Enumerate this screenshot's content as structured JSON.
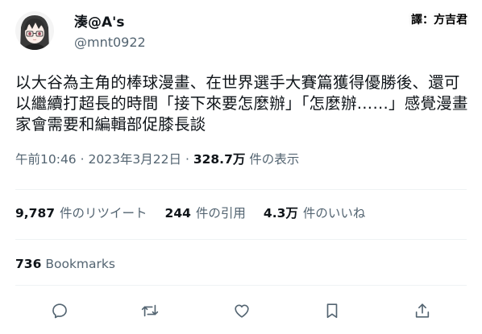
{
  "tweet": {
    "author": {
      "display_name": "湊@A's",
      "handle": "@mnt0922"
    },
    "text": "以大谷為主角的棒球漫畫、在世界選手大賽篇獲得優勝後、還可以繼續打超長的時間「接下來要怎麼辦」「怎麼辦……」感覺漫畫家會需要和編輯部促膝長談",
    "time": "午前10:46",
    "date": "2023年3月22日",
    "separator": "·",
    "views_count": "328.7万",
    "views_label": "件の表示"
  },
  "watermark": {
    "translator": "譯：方吉君"
  },
  "stats": [
    {
      "count": "9,787",
      "label": "件のリツイート"
    },
    {
      "count": "244",
      "label": "件の引用"
    },
    {
      "count": "4.3万",
      "label": "件のいいね"
    }
  ],
  "bookmarks": {
    "count": "736",
    "label": "Bookmarks"
  },
  "actions": [
    {
      "name": "reply-icon"
    },
    {
      "name": "retweet-icon"
    },
    {
      "name": "like-icon"
    },
    {
      "name": "bookmark-icon"
    },
    {
      "name": "share-icon"
    }
  ],
  "colors": {
    "text_primary": "#0f1419",
    "text_secondary": "#536471",
    "divider": "#eff3f4"
  }
}
